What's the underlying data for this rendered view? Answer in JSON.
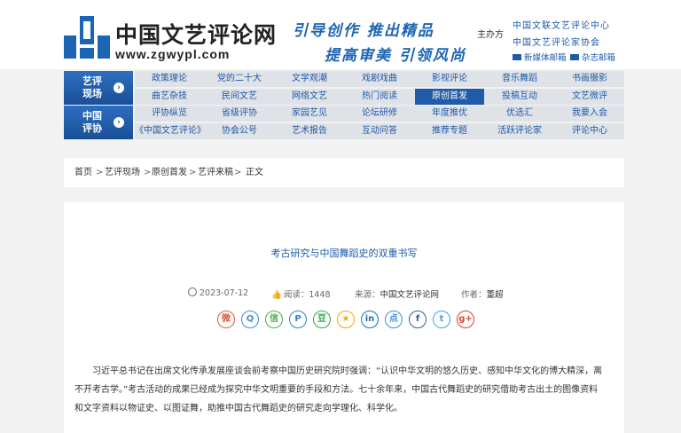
{
  "header": {
    "logo_cn": "中国文艺评论网",
    "logo_en": "www.zgwypl.com",
    "slogan1": "引导创作  推出精品",
    "slogan2": "提高审美  引领风尚",
    "host_label": "主办方",
    "host1": "中国文联文艺评论中心",
    "host2": "中国文艺评论家协会",
    "mail_new_media": "新媒体邮箱",
    "mail_magazine": "杂志邮箱",
    "colors": {
      "brand": "#1e5aa8",
      "slogan": "#1e64b4"
    }
  },
  "nav": {
    "sections": [
      {
        "label_line1": "艺评",
        "label_line2": "现场"
      },
      {
        "label_line1": "中国",
        "label_line2": "评协"
      }
    ],
    "rows": [
      [
        "政策理论",
        "党的二十大",
        "文学观潮",
        "戏剧戏曲",
        "影视评论",
        "音乐舞蹈",
        "书画摄影"
      ],
      [
        "曲艺杂技",
        "民间文艺",
        "网络文艺",
        "热门阅读",
        "原创首发",
        "投稿互动",
        "文艺微评"
      ],
      [
        "评协纵览",
        "省级评协",
        "家园艺见",
        "论坛研修",
        "年度推优",
        "优选汇",
        "我要入会"
      ],
      [
        "《中国文艺评论》",
        "协会公号",
        "艺术报告",
        "互动问答",
        "推荐专题",
        "活跃评论家",
        "评论中心"
      ]
    ],
    "active": "原创首发"
  },
  "breadcrumb": [
    "首页",
    "艺评现场",
    "原创首发",
    "艺评来稿",
    "正文"
  ],
  "article": {
    "title": "考古研究与中国舞蹈史的双重书写",
    "date": "2023-07-12",
    "reads_label": "阅读：",
    "reads": "1448",
    "source_label": "来源：",
    "source": "中国文艺评论网",
    "author_label": "作者：",
    "author": "董超",
    "share_icons": [
      "weibo-icon",
      "qq-icon",
      "wechat-icon",
      "pinterest-icon",
      "douban-icon",
      "qzone-icon",
      "linkedin-icon",
      "dianping-icon",
      "facebook-icon",
      "twitter-icon",
      "google-plus-icon"
    ],
    "para1": "习近平总书记在出席文化传承发展座谈会前考察中国历史研究院时强调：“认识中华文明的悠久历史、感知中华文化的博大精深，离",
    "para2": "不开考古学。”考古活动的成果已经成为探究中华文明重要的手段和方法。七十余年来，中国古代舞蹈史的研究借助考古出土的图像资料",
    "para3": "和文字资料以物证史、以图证舞，助推中国古代舞蹈史的研究走向学理化、科学化。"
  }
}
